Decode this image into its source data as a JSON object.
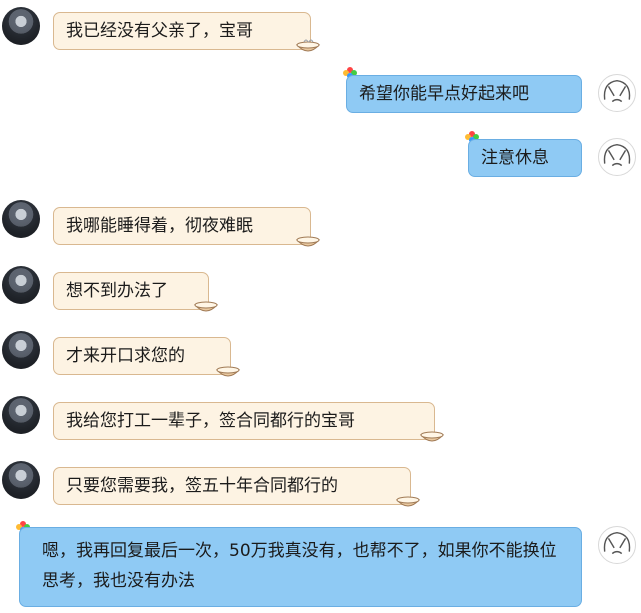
{
  "messages": [
    {
      "side": "left",
      "text": "我已经没有父亲了，宝哥"
    },
    {
      "side": "right",
      "text": "希望你能早点好起来吧"
    },
    {
      "side": "right",
      "text": "注意休息"
    },
    {
      "side": "left",
      "text": "我哪能睡得着，彻夜难眠"
    },
    {
      "side": "left",
      "text": "想不到办法了"
    },
    {
      "side": "left",
      "text": "才来开口求您的"
    },
    {
      "side": "left",
      "text": "我给您打工一辈子，签合同都行的宝哥"
    },
    {
      "side": "left",
      "text": "只要您需要我，签五十年合同都行的"
    },
    {
      "side": "right",
      "text": "嗯，我再回复最后一次，50万我真没有，也帮不了，如果你不能换位思考，我也没有办法"
    }
  ],
  "colors": {
    "left_bubble": "#fdf3e3",
    "left_border": "#d9b890",
    "right_bubble": "#8fcaf4",
    "right_border": "#6aaee3"
  },
  "icons": {
    "left_avatar": "dark-portrait-avatar",
    "right_avatar": "sketch-face-avatar",
    "left_deco": "bowl-icon",
    "right_deco": "flower-icon"
  }
}
